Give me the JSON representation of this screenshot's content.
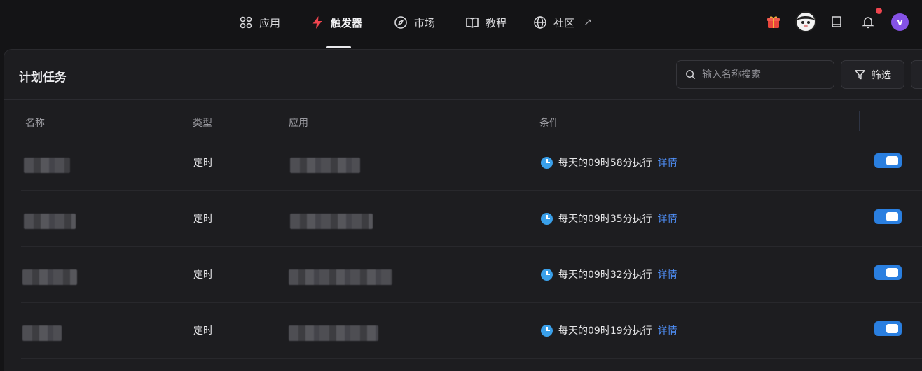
{
  "nav": {
    "items": [
      {
        "label": "应用",
        "icon": "apps-grid-icon"
      },
      {
        "label": "触发器",
        "icon": "lightning-icon"
      },
      {
        "label": "市场",
        "icon": "compass-icon"
      },
      {
        "label": "教程",
        "icon": "book-open-icon"
      },
      {
        "label": "社区",
        "icon": "globe-icon"
      }
    ],
    "active_index": 1,
    "external_arrow": "↗",
    "avatar_initial": "v",
    "accent_color": "#f0454f"
  },
  "panel": {
    "title": "计划任务",
    "search_placeholder": "输入名称搜索",
    "filter_label": "筛选"
  },
  "table": {
    "headers": [
      "名称",
      "类型",
      "应用",
      "条件"
    ],
    "rows": [
      {
        "type": "定时",
        "condition": "每天的09时58分执行",
        "detail": "详情",
        "enabled": true
      },
      {
        "type": "定时",
        "condition": "每天的09时35分执行",
        "detail": "详情",
        "enabled": true
      },
      {
        "type": "定时",
        "condition": "每天的09时32分执行",
        "detail": "详情",
        "enabled": true
      },
      {
        "type": "定时",
        "condition": "每天的09时19分执行",
        "detail": "详情",
        "enabled": true
      }
    ]
  }
}
